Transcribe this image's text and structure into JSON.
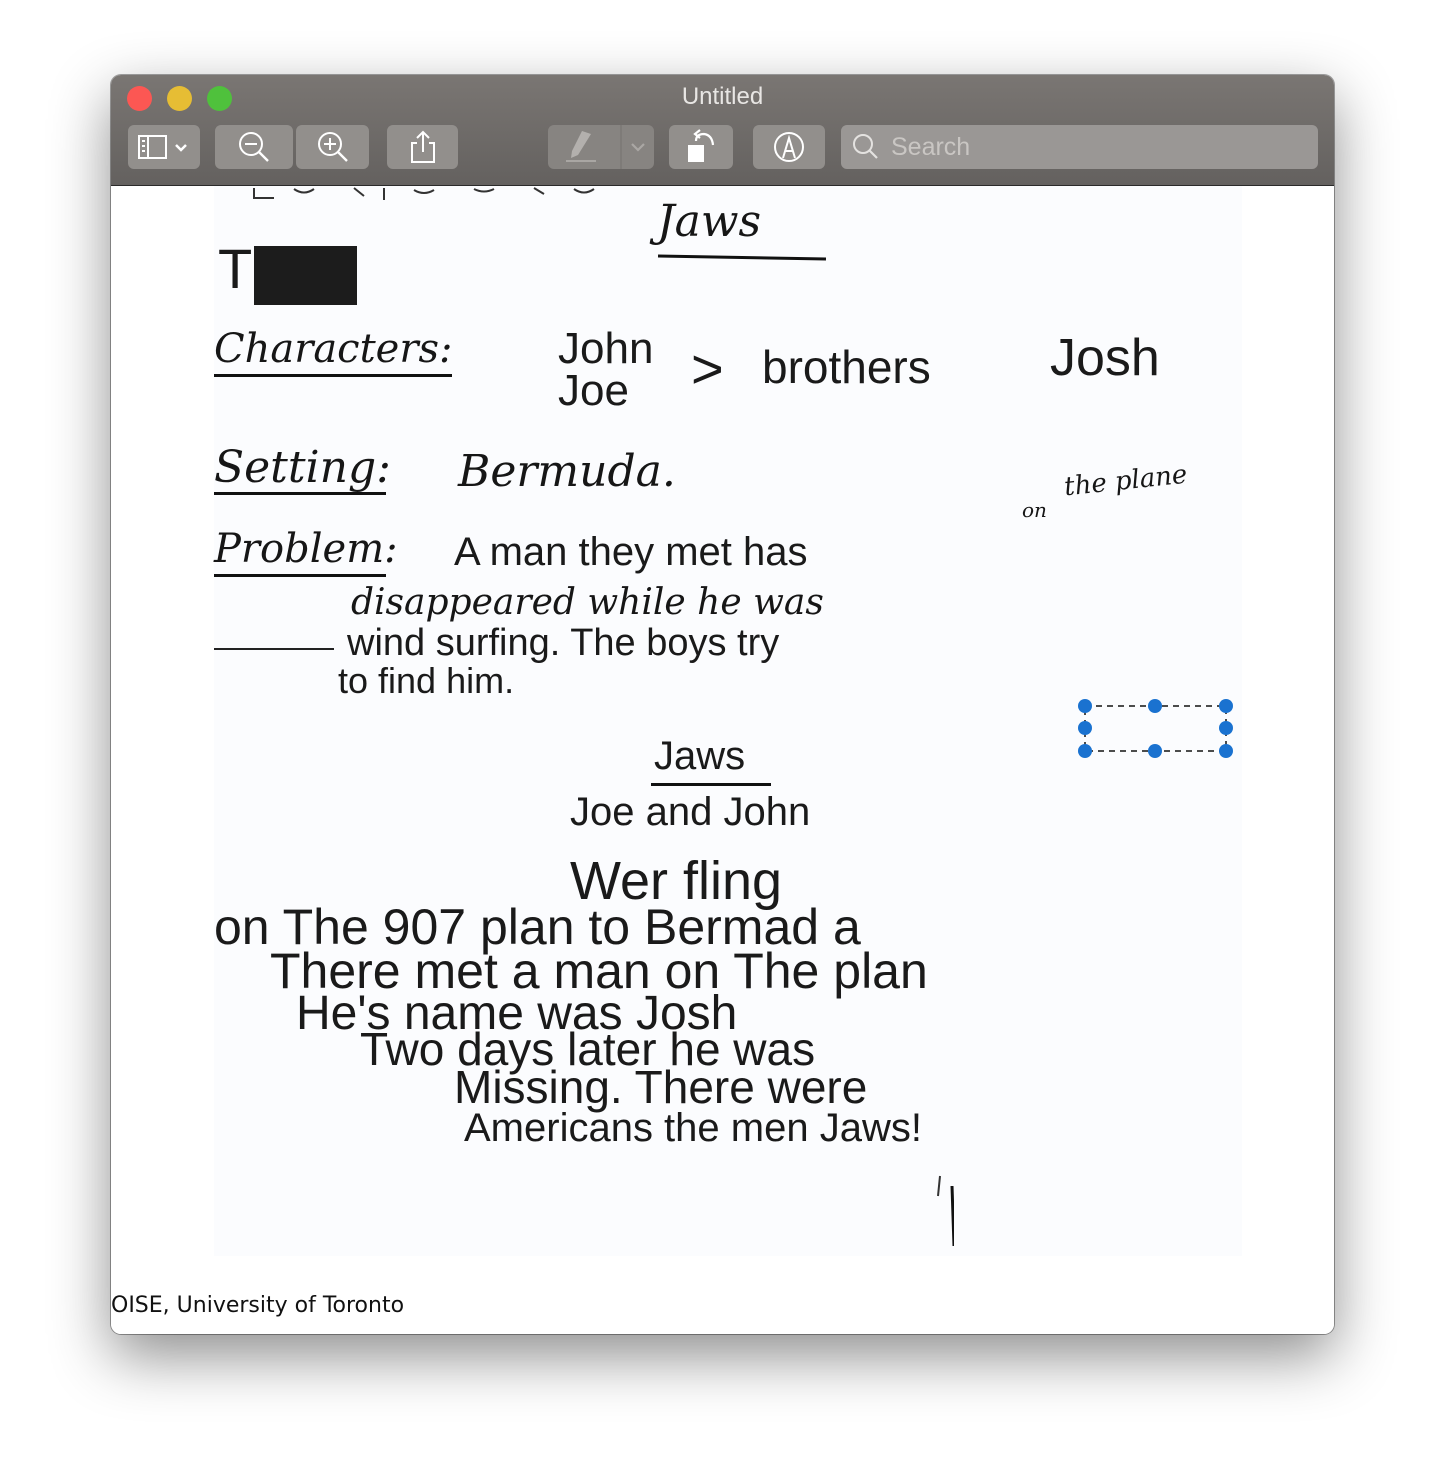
{
  "window": {
    "title": "Untitled"
  },
  "toolbar": {
    "sidebar_button": "sidebar-toggle",
    "zoom_out": "zoom-out",
    "zoom_in": "zoom-in",
    "share": "share",
    "highlight": "highlight",
    "rotate": "rotate-left",
    "markup": "markup",
    "search_placeholder": "Search",
    "search_value": ""
  },
  "document": {
    "heading1": "Jaws",
    "redacted_initial": "T",
    "characters_label": "Characters:",
    "characters_name1": "John",
    "characters_name2": "Joe",
    "characters_relation": "brothers",
    "characters_name3": "Josh",
    "setting_label": "Setting:",
    "setting_value": "Bermuda.",
    "insertion_above": "the plane",
    "insertion_on": "on",
    "problem_label": "Problem:",
    "problem_line1": "A man they met has",
    "problem_line2": "disappeared while he was",
    "problem_line3": "wind surfing. The boys try",
    "problem_line4": "to find him.",
    "heading2": "Jaws",
    "story_line1": "Joe and John",
    "story_line2": "Wer fling",
    "story_line3": "on The 907 plan to Bermad a",
    "story_line4": "There met a man on The plan",
    "story_line5": "He's name was Josh",
    "story_line6": "Two days later he was",
    "story_line7": "Missing. There were",
    "story_line8": "Americans the men Jaws!",
    "caption": "OISE, University of Toronto"
  },
  "colors": {
    "selection_handle": "#1a72d0",
    "titlebar": "#6f6c69"
  }
}
